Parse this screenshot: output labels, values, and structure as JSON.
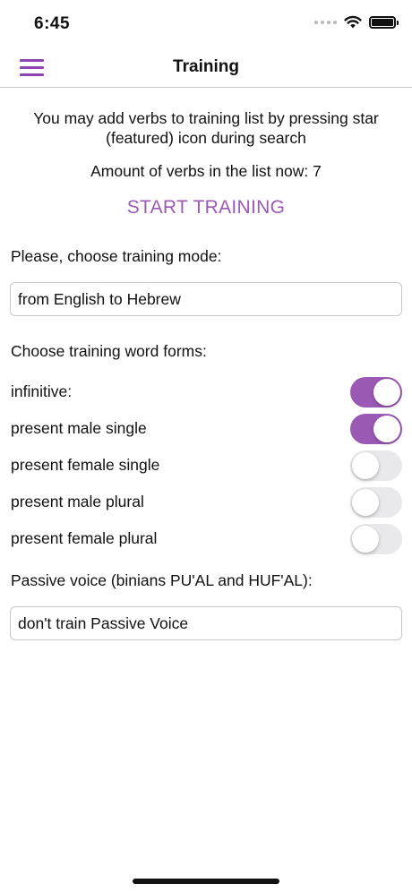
{
  "status_bar": {
    "time": "6:45"
  },
  "nav": {
    "title": "Training"
  },
  "info": {
    "description": "You may add verbs to training list by pressing star (featured) icon during search",
    "amount": "Amount of verbs in the list now: 7",
    "start_label": "START TRAINING"
  },
  "mode": {
    "label": "Please, choose training mode:",
    "value": "from English to Hebrew"
  },
  "forms": {
    "label": "Choose training word forms:",
    "items": [
      {
        "label": "infinitive:",
        "enabled": true
      },
      {
        "label": "present male single",
        "enabled": true
      },
      {
        "label": "present female single",
        "enabled": false
      },
      {
        "label": "present male plural",
        "enabled": false
      },
      {
        "label": "present female plural",
        "enabled": false
      }
    ]
  },
  "passive": {
    "label": "Passive voice (binians PU'AL and HUF'AL):",
    "value": "don't train Passive Voice"
  },
  "colors": {
    "accent": "#9b59b6",
    "toggle_off": "#e9e9eb"
  }
}
